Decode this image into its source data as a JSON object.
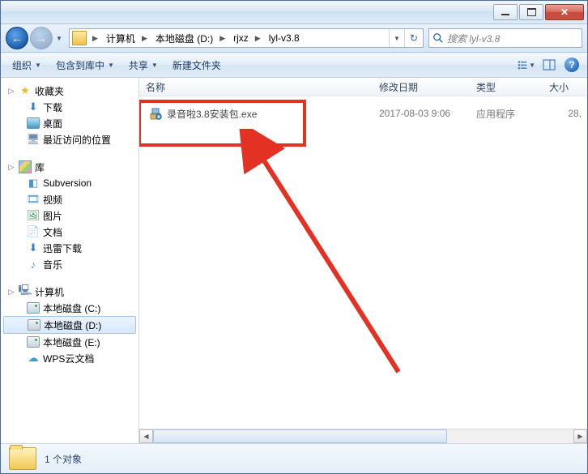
{
  "breadcrumb": {
    "computer": "计算机",
    "drive": "本地磁盘 (D:)",
    "folder1": "rjxz",
    "folder2": "lyl-v3.8"
  },
  "search": {
    "placeholder": "搜索 lyl-v3.8"
  },
  "toolbar": {
    "organize": "组织",
    "include": "包含到库中",
    "share": "共享",
    "newfolder": "新建文件夹"
  },
  "columns": {
    "name": "名称",
    "date": "修改日期",
    "type": "类型",
    "size": "大小"
  },
  "files": [
    {
      "name": "录音啦3.8安装包.exe",
      "date": "2017-08-03 9:06",
      "type": "应用程序",
      "size": "28,"
    }
  ],
  "sidebar": {
    "favorites": {
      "label": "收藏夹",
      "downloads": "下载",
      "desktop": "桌面",
      "recent": "最近访问的位置"
    },
    "libraries": {
      "label": "库",
      "svn": "Subversion",
      "video": "视频",
      "pictures": "图片",
      "documents": "文档",
      "xunlei": "迅雷下载",
      "music": "音乐"
    },
    "computer": {
      "label": "计算机",
      "c": "本地磁盘 (C:)",
      "d": "本地磁盘 (D:)",
      "e": "本地磁盘 (E:)",
      "wps": "WPS云文档"
    }
  },
  "status": {
    "count": "1 个对象"
  }
}
